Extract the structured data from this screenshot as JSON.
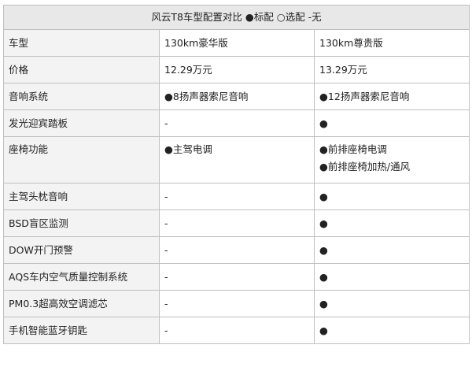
{
  "title": "风云T8车型配置对比 ●标配 ○选配 -无",
  "header": {
    "label": "车型",
    "col1": "130km豪华版",
    "col2": "130km尊贵版"
  },
  "rows": [
    {
      "label": "价格",
      "col1": [
        "12.29万元"
      ],
      "col2": [
        "13.29万元"
      ]
    },
    {
      "label": "音响系统",
      "col1": [
        "●8扬声器索尼音响"
      ],
      "col2": [
        "●12扬声器索尼音响"
      ]
    },
    {
      "label": "发光迎宾踏板",
      "col1": [
        "-"
      ],
      "col2": [
        "●"
      ]
    },
    {
      "label": "座椅功能",
      "col1": [
        "●主驾电调"
      ],
      "col2": [
        "●前排座椅电调",
        "●前排座椅加热/通风"
      ]
    },
    {
      "label": "主驾头枕音响",
      "col1": [
        "-"
      ],
      "col2": [
        "●"
      ]
    },
    {
      "label": "BSD盲区监测",
      "col1": [
        "-"
      ],
      "col2": [
        "●"
      ]
    },
    {
      "label": "DOW开门预警",
      "col1": [
        "-"
      ],
      "col2": [
        "●"
      ]
    },
    {
      "label": "AQS车内空气质量控制系统",
      "col1": [
        "-"
      ],
      "col2": [
        "●"
      ]
    },
    {
      "label": "PM0.3超高效空调滤芯",
      "col1": [
        "-"
      ],
      "col2": [
        "●"
      ]
    },
    {
      "label": "手机智能蓝牙钥匙",
      "col1": [
        "-"
      ],
      "col2": [
        "●"
      ]
    }
  ]
}
